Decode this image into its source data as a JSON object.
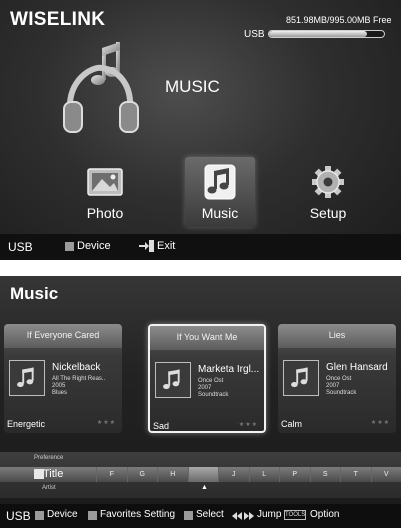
{
  "home": {
    "title": "WISELINK",
    "usb": {
      "label": "USB",
      "space": "851.98MB/995.00MB Free",
      "used_fraction": 0.856
    },
    "hero": {
      "label": "MUSIC",
      "icon": "music-headphones-icon"
    },
    "menu": [
      {
        "label": "Photo",
        "icon": "photo-icon",
        "selected": false
      },
      {
        "label": "Music",
        "icon": "music-note-icon",
        "selected": true
      },
      {
        "label": "Setup",
        "icon": "gear-icon",
        "selected": false
      }
    ],
    "footer": {
      "source": "USB",
      "device": "Device",
      "exit": "Exit"
    }
  },
  "music": {
    "title": "Music",
    "cards": [
      {
        "title": "If Everyone Cared",
        "artist": "Nickelback",
        "album": "All The Right Reas..",
        "year": "2005",
        "genre": "Blues",
        "mood": "Energetic",
        "stars": "★★★",
        "selected": false
      },
      {
        "title": "If You Want Me",
        "artist": "Marketa Irgl...",
        "album": "Once Ost",
        "year": "2007",
        "genre": "Soundtrack",
        "mood": "Sad",
        "stars": "★★★",
        "selected": true
      },
      {
        "title": "Lies",
        "artist": "Glen Hansard",
        "album": "Once Ost",
        "year": "2007",
        "genre": "Soundtrack",
        "mood": "Calm",
        "stars": "★★★",
        "selected": false
      }
    ],
    "sort": {
      "prev": "Preference",
      "current": "Title",
      "next": "Artist",
      "letters": [
        "F",
        "G",
        "H",
        "",
        "J",
        "L",
        "P",
        "S",
        "T",
        "V"
      ],
      "active_index": 3
    },
    "footer": {
      "source": "USB",
      "device": "Device",
      "favorites": "Favorites Setting",
      "select": "Select",
      "jump": "Jump",
      "tools": "TOOLS",
      "option": "Option"
    }
  }
}
